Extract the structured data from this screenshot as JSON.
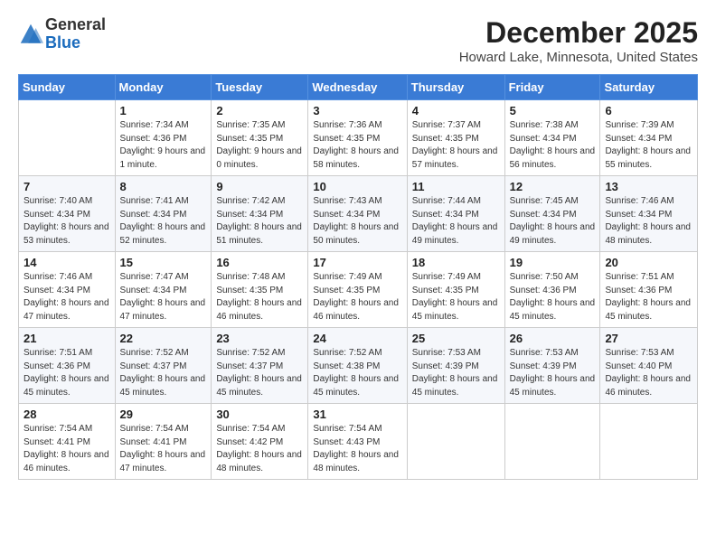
{
  "logo": {
    "general": "General",
    "blue": "Blue"
  },
  "header": {
    "month": "December 2025",
    "location": "Howard Lake, Minnesota, United States"
  },
  "weekdays": [
    "Sunday",
    "Monday",
    "Tuesday",
    "Wednesday",
    "Thursday",
    "Friday",
    "Saturday"
  ],
  "weeks": [
    [
      {
        "day": "",
        "sunrise": "",
        "sunset": "",
        "daylight": ""
      },
      {
        "day": "1",
        "sunrise": "Sunrise: 7:34 AM",
        "sunset": "Sunset: 4:36 PM",
        "daylight": "Daylight: 9 hours and 1 minute."
      },
      {
        "day": "2",
        "sunrise": "Sunrise: 7:35 AM",
        "sunset": "Sunset: 4:35 PM",
        "daylight": "Daylight: 9 hours and 0 minutes."
      },
      {
        "day": "3",
        "sunrise": "Sunrise: 7:36 AM",
        "sunset": "Sunset: 4:35 PM",
        "daylight": "Daylight: 8 hours and 58 minutes."
      },
      {
        "day": "4",
        "sunrise": "Sunrise: 7:37 AM",
        "sunset": "Sunset: 4:35 PM",
        "daylight": "Daylight: 8 hours and 57 minutes."
      },
      {
        "day": "5",
        "sunrise": "Sunrise: 7:38 AM",
        "sunset": "Sunset: 4:34 PM",
        "daylight": "Daylight: 8 hours and 56 minutes."
      },
      {
        "day": "6",
        "sunrise": "Sunrise: 7:39 AM",
        "sunset": "Sunset: 4:34 PM",
        "daylight": "Daylight: 8 hours and 55 minutes."
      }
    ],
    [
      {
        "day": "7",
        "sunrise": "Sunrise: 7:40 AM",
        "sunset": "Sunset: 4:34 PM",
        "daylight": "Daylight: 8 hours and 53 minutes."
      },
      {
        "day": "8",
        "sunrise": "Sunrise: 7:41 AM",
        "sunset": "Sunset: 4:34 PM",
        "daylight": "Daylight: 8 hours and 52 minutes."
      },
      {
        "day": "9",
        "sunrise": "Sunrise: 7:42 AM",
        "sunset": "Sunset: 4:34 PM",
        "daylight": "Daylight: 8 hours and 51 minutes."
      },
      {
        "day": "10",
        "sunrise": "Sunrise: 7:43 AM",
        "sunset": "Sunset: 4:34 PM",
        "daylight": "Daylight: 8 hours and 50 minutes."
      },
      {
        "day": "11",
        "sunrise": "Sunrise: 7:44 AM",
        "sunset": "Sunset: 4:34 PM",
        "daylight": "Daylight: 8 hours and 49 minutes."
      },
      {
        "day": "12",
        "sunrise": "Sunrise: 7:45 AM",
        "sunset": "Sunset: 4:34 PM",
        "daylight": "Daylight: 8 hours and 49 minutes."
      },
      {
        "day": "13",
        "sunrise": "Sunrise: 7:46 AM",
        "sunset": "Sunset: 4:34 PM",
        "daylight": "Daylight: 8 hours and 48 minutes."
      }
    ],
    [
      {
        "day": "14",
        "sunrise": "Sunrise: 7:46 AM",
        "sunset": "Sunset: 4:34 PM",
        "daylight": "Daylight: 8 hours and 47 minutes."
      },
      {
        "day": "15",
        "sunrise": "Sunrise: 7:47 AM",
        "sunset": "Sunset: 4:34 PM",
        "daylight": "Daylight: 8 hours and 47 minutes."
      },
      {
        "day": "16",
        "sunrise": "Sunrise: 7:48 AM",
        "sunset": "Sunset: 4:35 PM",
        "daylight": "Daylight: 8 hours and 46 minutes."
      },
      {
        "day": "17",
        "sunrise": "Sunrise: 7:49 AM",
        "sunset": "Sunset: 4:35 PM",
        "daylight": "Daylight: 8 hours and 46 minutes."
      },
      {
        "day": "18",
        "sunrise": "Sunrise: 7:49 AM",
        "sunset": "Sunset: 4:35 PM",
        "daylight": "Daylight: 8 hours and 45 minutes."
      },
      {
        "day": "19",
        "sunrise": "Sunrise: 7:50 AM",
        "sunset": "Sunset: 4:36 PM",
        "daylight": "Daylight: 8 hours and 45 minutes."
      },
      {
        "day": "20",
        "sunrise": "Sunrise: 7:51 AM",
        "sunset": "Sunset: 4:36 PM",
        "daylight": "Daylight: 8 hours and 45 minutes."
      }
    ],
    [
      {
        "day": "21",
        "sunrise": "Sunrise: 7:51 AM",
        "sunset": "Sunset: 4:36 PM",
        "daylight": "Daylight: 8 hours and 45 minutes."
      },
      {
        "day": "22",
        "sunrise": "Sunrise: 7:52 AM",
        "sunset": "Sunset: 4:37 PM",
        "daylight": "Daylight: 8 hours and 45 minutes."
      },
      {
        "day": "23",
        "sunrise": "Sunrise: 7:52 AM",
        "sunset": "Sunset: 4:37 PM",
        "daylight": "Daylight: 8 hours and 45 minutes."
      },
      {
        "day": "24",
        "sunrise": "Sunrise: 7:52 AM",
        "sunset": "Sunset: 4:38 PM",
        "daylight": "Daylight: 8 hours and 45 minutes."
      },
      {
        "day": "25",
        "sunrise": "Sunrise: 7:53 AM",
        "sunset": "Sunset: 4:39 PM",
        "daylight": "Daylight: 8 hours and 45 minutes."
      },
      {
        "day": "26",
        "sunrise": "Sunrise: 7:53 AM",
        "sunset": "Sunset: 4:39 PM",
        "daylight": "Daylight: 8 hours and 45 minutes."
      },
      {
        "day": "27",
        "sunrise": "Sunrise: 7:53 AM",
        "sunset": "Sunset: 4:40 PM",
        "daylight": "Daylight: 8 hours and 46 minutes."
      }
    ],
    [
      {
        "day": "28",
        "sunrise": "Sunrise: 7:54 AM",
        "sunset": "Sunset: 4:41 PM",
        "daylight": "Daylight: 8 hours and 46 minutes."
      },
      {
        "day": "29",
        "sunrise": "Sunrise: 7:54 AM",
        "sunset": "Sunset: 4:41 PM",
        "daylight": "Daylight: 8 hours and 47 minutes."
      },
      {
        "day": "30",
        "sunrise": "Sunrise: 7:54 AM",
        "sunset": "Sunset: 4:42 PM",
        "daylight": "Daylight: 8 hours and 48 minutes."
      },
      {
        "day": "31",
        "sunrise": "Sunrise: 7:54 AM",
        "sunset": "Sunset: 4:43 PM",
        "daylight": "Daylight: 8 hours and 48 minutes."
      },
      {
        "day": "",
        "sunrise": "",
        "sunset": "",
        "daylight": ""
      },
      {
        "day": "",
        "sunrise": "",
        "sunset": "",
        "daylight": ""
      },
      {
        "day": "",
        "sunrise": "",
        "sunset": "",
        "daylight": ""
      }
    ]
  ]
}
